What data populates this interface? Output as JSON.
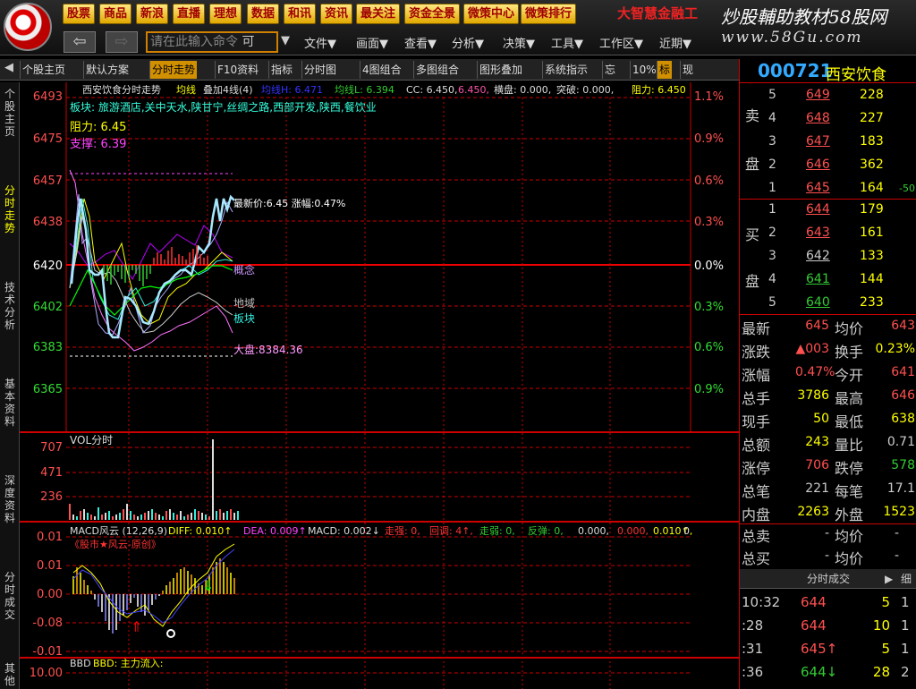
{
  "topbar": {
    "buttons": [
      "股票",
      "商品",
      "新浪",
      "直播",
      "理想",
      "数据",
      "和讯",
      "资讯",
      "最关注",
      "资金全景",
      "微策中心",
      "微策排行"
    ],
    "brand": "大智慧金融工",
    "watermark_line1": "炒股輔助教材58股网",
    "watermark_line2": "www.58Gu.com",
    "command_placeholder": "请在此输入命令",
    "command_suffix": "可",
    "menus": [
      "文件▼",
      "画面▼",
      "查看▼",
      "分析▼",
      "决策▼",
      "工具▼",
      "工作区▼",
      "近期▼"
    ]
  },
  "toolbar2": [
    "个股主页",
    "默认方案",
    "分时走势",
    "F10资料",
    "指标",
    "分时图",
    "4图组合",
    "多图组合",
    "图形叠加",
    "系统指示",
    "忘",
    "10%",
    "标",
    "现"
  ],
  "vtabs": [
    "个股主页",
    "分时走势",
    "技术分析",
    "基本资料",
    "深度资料",
    "分时成交",
    "其他"
  ],
  "chart_header": {
    "title": "西安饮食分时走势",
    "avg_label": "均线",
    "overlay": "叠加4线(4)",
    "avgH": "均线H: 6.471",
    "avgL": "均线L: 6.394",
    "cc": "CC: 6.450,",
    "cc2": "6.450,",
    "hz": "横盘: 0.000,",
    "tp": "突破: 0.000,",
    "zl": "阻力: 6.450"
  },
  "plate": "板块: 旅游酒店,关中天水,陕甘宁,丝绸之路,西部开发,陕西,餐饮业",
  "resistance": "阻力: 6.45",
  "support": "支撑: 6.39",
  "price_axis": [
    "6493",
    "6475",
    "6457",
    "6438",
    "6420",
    "6402",
    "6383",
    "6365"
  ],
  "pct_axis": [
    "1.1%",
    "0.9%",
    "0.6%",
    "0.3%",
    "0.0%",
    "0.3%",
    "0.6%",
    "0.9%"
  ],
  "latest_label": "最新价:6.45 涨幅:0.47%",
  "series_labels": [
    "概念",
    "地域",
    "板块",
    "大盘:8384.36"
  ],
  "vol": {
    "label": "VOL分时",
    "axis": [
      "707",
      "471",
      "236"
    ]
  },
  "macd": {
    "label": "MACD风云 (12,26,9)",
    "diff": "DIFF: 0.010↑",
    "dea": "DEA: 0.009↑",
    "macdv": "MACD: 0.002↓",
    "zq": "走强: 0,",
    "hd": "回调: 4↑,",
    "zr": "走弱: 0,",
    "ft": "反弹: 0,",
    "rest": "0.000,",
    "rest2": "0.000,",
    "rest3": "0.010↑,",
    "rest4": "0",
    "sub": "《股市★风云-原创》",
    "axis": [
      "0.01",
      "0.01",
      "0.00",
      "-0.08",
      "-0.01"
    ]
  },
  "bbd": {
    "label": "BBD",
    "sub": "BBD: 主力流入:",
    "axis": [
      "10.00"
    ]
  },
  "stock": {
    "code": "000721",
    "name": "西安饮食"
  },
  "sell": [
    {
      "lvl": "5",
      "p": "649",
      "v": "228"
    },
    {
      "lvl": "4",
      "p": "648",
      "v": "227"
    },
    {
      "lvl": "3",
      "p": "647",
      "v": "183"
    },
    {
      "lvl": "2",
      "p": "646",
      "v": "362"
    },
    {
      "lvl": "1",
      "p": "645",
      "v": "164",
      "d": "-50"
    }
  ],
  "buy": [
    {
      "lvl": "1",
      "p": "644",
      "v": "179"
    },
    {
      "lvl": "2",
      "p": "643",
      "v": "161"
    },
    {
      "lvl": "3",
      "p": "642",
      "v": "133"
    },
    {
      "lvl": "4",
      "p": "641",
      "v": "144"
    },
    {
      "lvl": "5",
      "p": "640",
      "v": "233"
    }
  ],
  "sell_group": [
    "卖",
    "盘"
  ],
  "buy_group": [
    "买",
    "盘"
  ],
  "quote": [
    {
      "l1": "最新",
      "v1": "645",
      "l2": "均价",
      "v2": "643"
    },
    {
      "l1": "涨跌",
      "v1": "▲003",
      "l2": "换手",
      "v2": "0.23%"
    },
    {
      "l1": "涨幅",
      "v1": "0.47%",
      "l2": "今开",
      "v2": "641"
    },
    {
      "l1": "总手",
      "v1": "3786",
      "l2": "最高",
      "v2": "646"
    },
    {
      "l1": "现手",
      "v1": "50",
      "l2": "最低",
      "v2": "638"
    },
    {
      "l1": "总额",
      "v1": "243",
      "l2": "量比",
      "v2": "0.71"
    },
    {
      "l1": "涨停",
      "v1": "706",
      "l2": "跌停",
      "v2": "578"
    },
    {
      "l1": "总笔",
      "v1": "221",
      "l2": "每笔",
      "v2": "17.1"
    },
    {
      "l1": "内盘",
      "v1": "2263",
      "l2": "外盘",
      "v2": "1523"
    }
  ],
  "sums": [
    {
      "l1": "总卖",
      "v1": "-",
      "l2": "均价",
      "v2": "-"
    },
    {
      "l1": "总买",
      "v1": "-",
      "l2": "均价",
      "v2": "-"
    }
  ],
  "tick_title": "分时成交",
  "tick_detail": "细",
  "ticks": [
    {
      "t": "10:32",
      "p": "644",
      "v": "5",
      "n": "1"
    },
    {
      "t": ":28",
      "p": "644",
      "v": "10",
      "n": "1"
    },
    {
      "t": ":31",
      "p": "645↑",
      "v": "5",
      "n": "1"
    },
    {
      "t": ":36",
      "p": "644↓",
      "v": "28",
      "n": "2"
    }
  ]
}
